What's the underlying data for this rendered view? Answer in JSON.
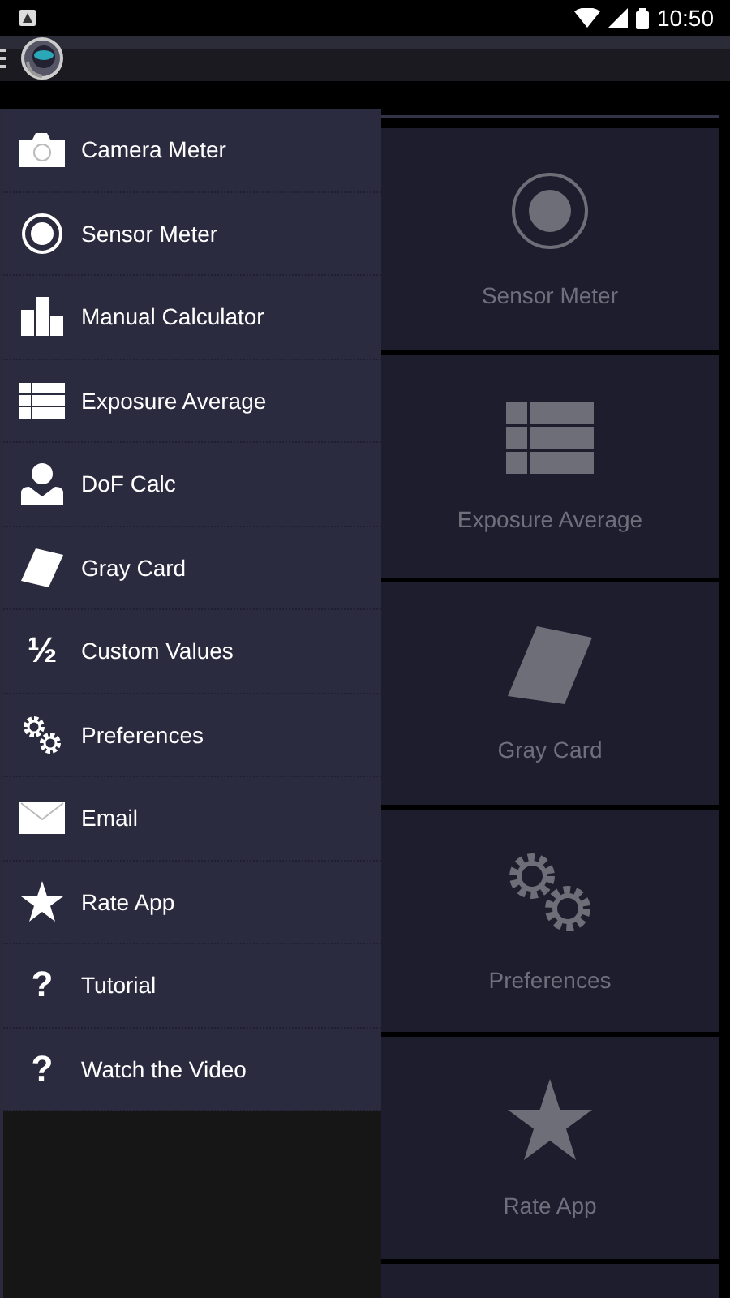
{
  "status_bar": {
    "time": "10:50"
  },
  "drawer": {
    "items": [
      {
        "label": "Camera Meter",
        "selected": false
      },
      {
        "label": "Sensor Meter",
        "selected": false
      },
      {
        "label": "Manual Calculator",
        "selected": false
      },
      {
        "label": "Exposure Average",
        "selected": false
      },
      {
        "label": "DoF Calc",
        "selected": false
      },
      {
        "label": "Gray Card",
        "selected": false
      },
      {
        "label": "Custom Values",
        "selected": false,
        "glyph": "½"
      },
      {
        "label": "Preferences",
        "selected": false
      },
      {
        "label": "Email",
        "selected": false
      },
      {
        "label": "Rate App",
        "selected": false
      },
      {
        "label": "Tutorial",
        "selected": false,
        "glyph": "?"
      },
      {
        "label": "Watch the Video",
        "selected": false,
        "glyph": "?"
      }
    ]
  },
  "tiles": [
    {
      "label": "Sensor Meter"
    },
    {
      "label": "Exposure Average"
    },
    {
      "label": "Gray Card"
    },
    {
      "label": "Preferences"
    },
    {
      "label": "Rate App"
    }
  ]
}
